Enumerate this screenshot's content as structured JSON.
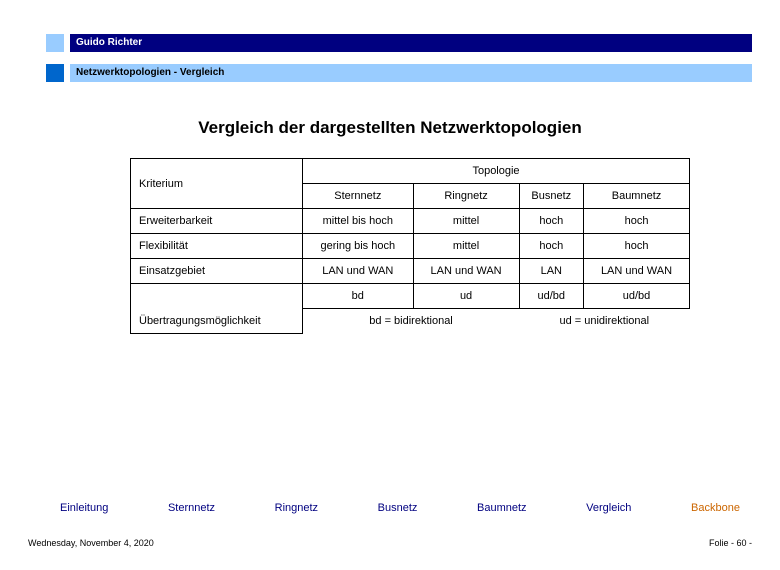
{
  "header": {
    "author": "Guido Richter",
    "breadcrumb": "Netzwerktopologien  - Vergleich"
  },
  "title": "Vergleich der dargestellten Netzwerktopologien",
  "table": {
    "criterion_label": "Kriterium",
    "topology_label": "Topologie",
    "cols": [
      "Sternnetz",
      "Ringnetz",
      "Busnetz",
      "Baumnetz"
    ],
    "rows": [
      {
        "crit": "Erweiterbarkeit",
        "vals": [
          "mittel bis hoch",
          "mittel",
          "hoch",
          "hoch"
        ]
      },
      {
        "crit": "Flexibilität",
        "vals": [
          "gering bis hoch",
          "mittel",
          "hoch",
          "hoch"
        ]
      },
      {
        "crit": "Einsatzgebiet",
        "vals": [
          "LAN und WAN",
          "LAN und WAN",
          "LAN",
          "LAN und WAN"
        ]
      },
      {
        "crit": "",
        "vals": [
          "bd",
          "ud",
          "ud/bd",
          "ud/bd"
        ]
      }
    ],
    "ubertragung_label": "Übertragungsmöglichkeit",
    "legend_bd": "bd = bidirektional",
    "legend_ud": "ud = unidirektional"
  },
  "nav": {
    "items": [
      "Einleitung",
      "Sternnetz",
      "Ringnetz",
      "Busnetz",
      "Baumnetz",
      "Vergleich",
      "Backbone"
    ],
    "active": "Backbone"
  },
  "footer": {
    "date": "Wednesday, November 4, 2020",
    "folie": "Folie - 60 -"
  }
}
